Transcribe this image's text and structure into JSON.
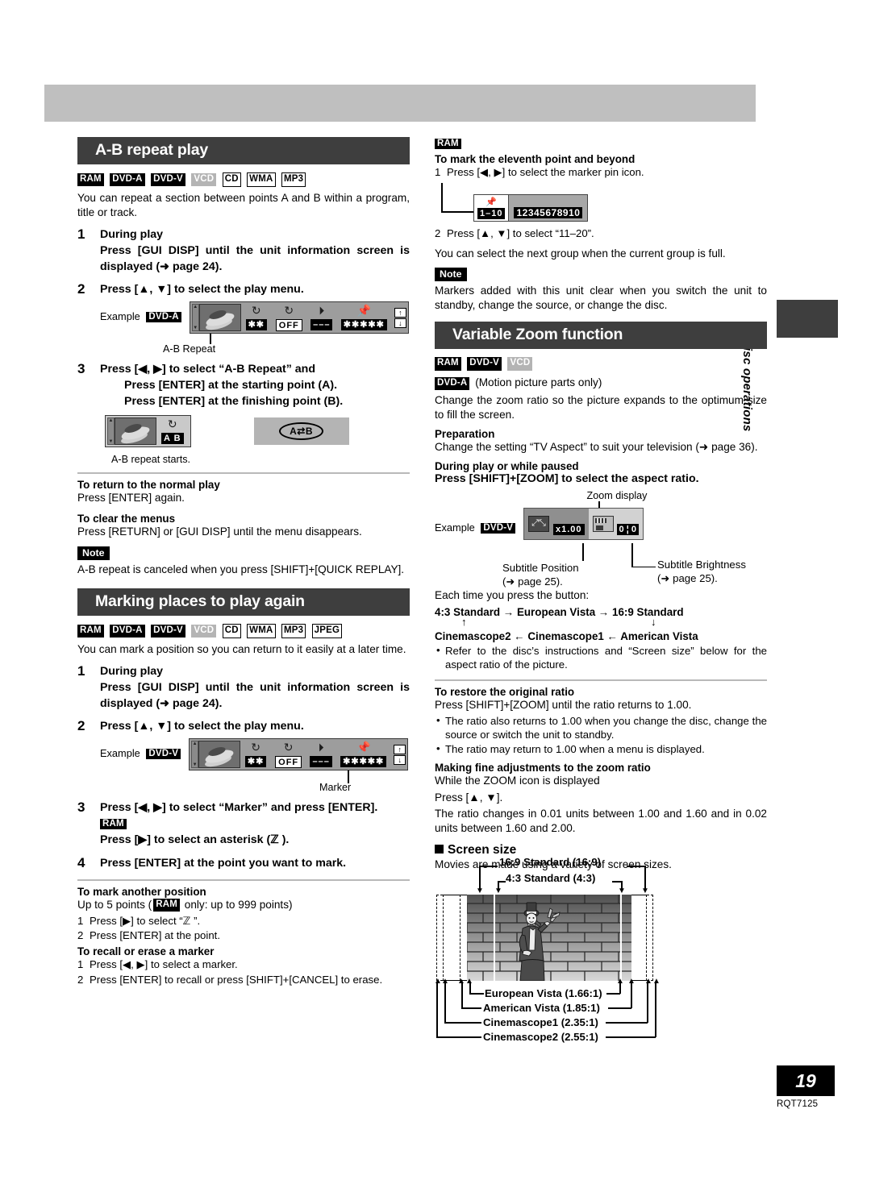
{
  "side_tab": {
    "label": "Disc operations"
  },
  "footer": {
    "page_number": "19",
    "doc_code": "RQT7125"
  },
  "left_column": {
    "section1": {
      "title": "A-B repeat play",
      "badges": [
        {
          "text": "RAM",
          "style": "dark"
        },
        {
          "text": "DVD-A",
          "style": "dark"
        },
        {
          "text": "DVD-V",
          "style": "dark"
        },
        {
          "text": "VCD",
          "style": "gray"
        },
        {
          "text": "CD",
          "style": "light"
        },
        {
          "text": "WMA",
          "style": "light"
        },
        {
          "text": "MP3",
          "style": "light"
        }
      ],
      "intro": "You can repeat a section between points A and B within a program, title or track.",
      "step1": {
        "num": "1",
        "line1": "During play",
        "line2": "Press [GUI DISP] until the unit information screen is displayed (➜ page 24)."
      },
      "step2": {
        "num": "2",
        "line1": "Press [▲, ▼] to select the play menu.",
        "example_label": "Example",
        "example_badge": "DVD-A",
        "gui": {
          "cells": [
            {
              "icon": "repeat-single-icon",
              "value": "✱✱",
              "value_style": "dark"
            },
            {
              "icon": "repeat-icon",
              "value": "OFF",
              "value_style": "box"
            },
            {
              "icon": "play-mode-icon",
              "value": "–––",
              "value_style": "dark"
            },
            {
              "icon": "marker-pin-icon",
              "value": "✱✱✱✱✱",
              "value_style": "dark"
            }
          ],
          "updown": [
            "↑",
            "↓"
          ]
        },
        "callout": "A-B Repeat"
      },
      "step3": {
        "num": "3",
        "line1": "Press [◀, ▶] to select “A-B Repeat” and",
        "line2": "Press [ENTER] at the starting point (A).",
        "line3": "Press [ENTER] at the finishing point (B).",
        "ab_icon_value": "A B",
        "osd_pill": "A⇄B",
        "caption": "A-B repeat starts."
      },
      "tip1": {
        "head": "To return to the normal play",
        "body": "Press [ENTER] again."
      },
      "tip2": {
        "head": "To clear the menus",
        "body": "Press [RETURN] or [GUI DISP] until the menu disappears."
      },
      "note": {
        "tag": "Note",
        "body": "A-B repeat is canceled when you press [SHIFT]+[QUICK REPLAY]."
      }
    },
    "section2": {
      "title": "Marking places to play again",
      "badges": [
        {
          "text": "RAM",
          "style": "dark"
        },
        {
          "text": "DVD-A",
          "style": "dark"
        },
        {
          "text": "DVD-V",
          "style": "dark"
        },
        {
          "text": "VCD",
          "style": "gray"
        },
        {
          "text": "CD",
          "style": "light"
        },
        {
          "text": "WMA",
          "style": "light"
        },
        {
          "text": "MP3",
          "style": "light"
        },
        {
          "text": "JPEG",
          "style": "light"
        }
      ],
      "intro": "You can mark a position so you can return to it easily at a later time.",
      "step1": {
        "num": "1",
        "line1": "During play",
        "line2": "Press [GUI DISP] until the unit information screen is displayed (➜ page 24)."
      },
      "step2": {
        "num": "2",
        "line1": "Press [▲, ▼] to select the play menu.",
        "example_label": "Example",
        "example_badge": "DVD-V",
        "gui": {
          "cells": [
            {
              "icon": "repeat-single-icon",
              "value": "✱✱",
              "value_style": "dark"
            },
            {
              "icon": "repeat-icon",
              "value": "OFF",
              "value_style": "box"
            },
            {
              "icon": "play-mode-icon",
              "value": "–––",
              "value_style": "dark"
            },
            {
              "icon": "marker-pin-icon",
              "value": "✱✱✱✱✱",
              "value_style": "dark"
            }
          ],
          "updown": [
            "↑",
            "↓"
          ]
        },
        "callout": "Marker"
      },
      "step3": {
        "num": "3",
        "line1": "Press [◀, ▶] to select “Marker” and press [ENTER].",
        "badge": "RAM",
        "line2": "Press [▶] to select an asterisk (ℤ )."
      },
      "step4": {
        "num": "4",
        "line1": "Press [ENTER] at the point you want to mark."
      },
      "tip1": {
        "head": "To mark another position",
        "body": "Up to 5 points (",
        "body_badge": "RAM",
        "body_tail": " only: up to 999 points)",
        "items": [
          "Press [▶] to select “ℤ ”.",
          "Press [ENTER] at the point."
        ]
      },
      "tip2": {
        "head": "To recall or erase a marker",
        "items": [
          "Press [◀, ▶] to select a marker.",
          "Press [ENTER] to recall or press [SHIFT]+[CANCEL] to erase."
        ]
      }
    }
  },
  "right_column": {
    "marker_block": {
      "badge": "RAM",
      "head": "To mark the eleventh point and beyond",
      "item1_num": "1",
      "item1": "Press [◀, ▶] to select the marker pin icon.",
      "pin_group_value": "1–10",
      "pin_group_numbers": "12345678910",
      "item2_num": "2",
      "item2": "Press [▲, ▼] to select “11–20”.",
      "note_line": "You can select the next group when the current group is full.",
      "note_tag": "Note",
      "note_body": "Markers added with this unit clear when you switch the unit to standby, change the source, or change the disc."
    },
    "section3": {
      "title": "Variable Zoom function",
      "badges": [
        {
          "text": "RAM",
          "style": "dark"
        },
        {
          "text": "DVD-V",
          "style": "dark"
        },
        {
          "text": "VCD",
          "style": "gray"
        }
      ],
      "badge_dvda": "DVD-A",
      "dvda_note": "(Motion picture parts only)",
      "intro": "Change the zoom ratio so the picture expands to the optimum size to fill the screen.",
      "prep_head": "Preparation",
      "prep_body": "Change the setting “TV Aspect” to suit your television (➜ page 36).",
      "during_head": "During play or while paused",
      "during_bold": "Press [SHIFT]+[ZOOM] to select the aspect ratio.",
      "zoom_display_label": "Zoom display",
      "example_label": "Example",
      "example_badge": "DVD-V",
      "zoom_value": "x1.00",
      "subtitle_values": "0  ¦  0",
      "subtitle_position_label": "Subtitle Position",
      "subtitle_position_page": "(➜ page 25).",
      "subtitle_brightness_label": "Subtitle Brightness",
      "subtitle_brightness_page": "(➜ page 25).",
      "each_press": "Each time you press the button:",
      "cycle_row1": "4:3 Standard → European Vista → 16:9 Standard",
      "cycle_up_arrow": "↑",
      "cycle_down_arrow": "↓",
      "cycle_row2": "Cinemascope2 ← Cinemascope1 ← American Vista",
      "bullet1": "Refer to the disc’s instructions and “Screen size” below for the aspect ratio of the picture.",
      "restore_head": "To restore the original ratio",
      "restore_body": "Press [SHIFT]+[ZOOM] until the ratio returns to 1.00.",
      "restore_bullets": [
        "The ratio also returns to 1.00 when you change the disc, change the source or switch the unit to standby.",
        "The ratio may return to 1.00 when a menu is displayed."
      ],
      "fine_head": "Making fine adjustments to the zoom ratio",
      "fine_line1": "While the ZOOM icon is displayed",
      "fine_line2": "Press [▲, ▼].",
      "fine_line3": "The ratio changes in 0.01 units between 1.00 and 1.60 and in 0.02 units between 1.60 and 2.00.",
      "screen_size_head": "Screen size",
      "screen_size_body": "Movies are made using a variety of screen sizes.",
      "figure": {
        "top_labels": [
          "16:9 Standard (16:9)",
          "4:3 Standard (4:3)"
        ],
        "bottom_labels": [
          "European Vista (1.66:1)",
          "American Vista (1.85:1)",
          "Cinemascope1 (2.35:1)",
          "Cinemascope2 (2.55:1)"
        ]
      }
    }
  }
}
